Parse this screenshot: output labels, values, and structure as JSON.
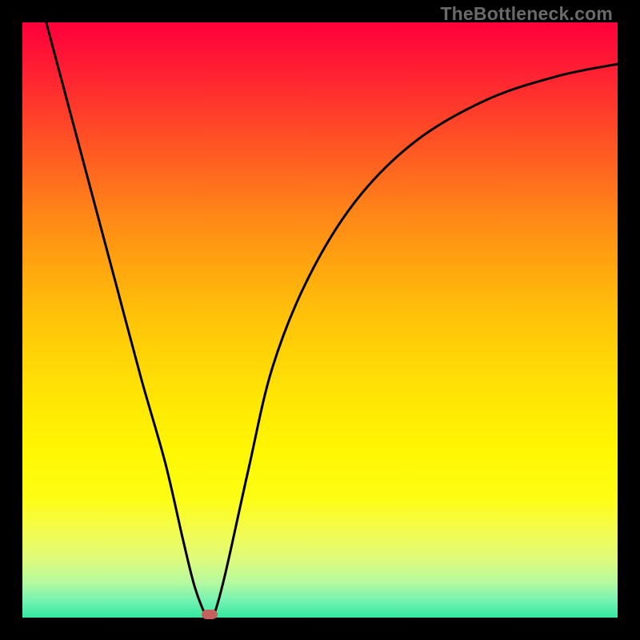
{
  "watermark": "TheBottleneck.com",
  "chart_data": {
    "type": "line",
    "title": "",
    "xlabel": "",
    "ylabel": "",
    "xlim": [
      0,
      100
    ],
    "ylim": [
      0,
      100
    ],
    "grid": false,
    "legend": false,
    "background": {
      "type": "vertical-gradient",
      "stops": [
        {
          "pos": 0,
          "color": "#ff003b"
        },
        {
          "pos": 50,
          "color": "#ffcc08"
        },
        {
          "pos": 80,
          "color": "#fdfd14"
        },
        {
          "pos": 100,
          "color": "#33e8a0"
        }
      ]
    },
    "series": [
      {
        "name": "bottleneck-curve",
        "color": "#000000",
        "x": [
          4,
          8,
          12,
          16,
          20,
          24,
          27,
          29,
          31,
          32,
          34,
          38,
          42,
          48,
          56,
          66,
          78,
          90,
          100
        ],
        "y": [
          100,
          85,
          70,
          55,
          40,
          26,
          13,
          5,
          0,
          0,
          7,
          25,
          42,
          57,
          70,
          80,
          87,
          91,
          93
        ]
      }
    ],
    "marker": {
      "name": "optimal-point",
      "x": 31.5,
      "y": 0,
      "color": "#c5625d",
      "shape": "rounded-rect"
    }
  }
}
